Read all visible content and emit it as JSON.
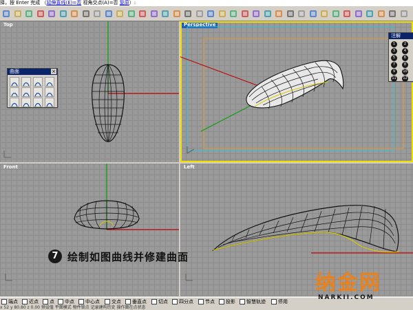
{
  "command_line": {
    "prefix": "择，按 Enter 完成 （",
    "opt1": "延伸直线(E)=否",
    "sep1": "  视角交点(A)=否",
    "opt2": "复原",
    "suffix": "）:"
  },
  "toolbar": {
    "icons": [
      "new-file-icon",
      "open-icon",
      "save-icon",
      "print-icon",
      "cut-icon",
      "copy-icon",
      "paste-icon",
      "undo-icon",
      "redo-icon",
      "hand-pan-icon",
      "rotate-view-icon",
      "zoom-dynamic-icon",
      "zoom-window-icon",
      "zoom-extents-icon",
      "zoom-selected-icon",
      "four-view-icon",
      "grid-icon",
      "construction-plane-icon",
      "set-view-icon",
      "lightbulb-icon",
      "shaded-icon",
      "rendered-icon",
      "material-icon",
      "sphere-render-icon",
      "render-icon",
      "car-icon",
      "properties-icon",
      "layer-icon",
      "object-snap-icon",
      "select-icon",
      "lock-icon",
      "wireframe-icon",
      "hide-icon",
      "show-icon",
      "edit-icon",
      "tag-icon"
    ]
  },
  "viewports": {
    "top": {
      "title": "Top"
    },
    "perspective": {
      "title": "Perspective"
    },
    "front": {
      "title": "Front"
    },
    "right": {
      "title": "Left"
    }
  },
  "surface_panel": {
    "title": "曲面"
  },
  "notes_panel": {
    "title": "注解",
    "items": [
      "1",
      "2",
      "3",
      "4",
      "5",
      "6",
      "7",
      "8",
      "9",
      "10",
      "11",
      "12"
    ]
  },
  "annotation": {
    "step_number": "7",
    "text": "绘制如图曲线并修建曲面"
  },
  "osnap": {
    "items": [
      {
        "label": "端点",
        "checked": false
      },
      {
        "label": "近点",
        "checked": false
      },
      {
        "label": "点",
        "checked": false
      },
      {
        "label": "中点",
        "checked": false
      },
      {
        "label": "中心点",
        "checked": false
      },
      {
        "label": "交点",
        "checked": false
      },
      {
        "label": "垂直点",
        "checked": false
      },
      {
        "label": "切点",
        "checked": false
      },
      {
        "label": "四分点",
        "checked": false
      },
      {
        "label": "节点",
        "checked": false
      },
      {
        "label": "投影",
        "checked": false
      },
      {
        "label": "智慧轨迹",
        "checked": false
      },
      {
        "label": "停用",
        "checked": false
      }
    ],
    "status_row": "x 52        y 80.80   z 0.00     预设值         平面模式     物件锁点     记录建构历史    操作面在点状态"
  },
  "watermark": {
    "main": "纳金网",
    "sub": "NARKII.COM"
  },
  "colors": {
    "viewport_bg": "#9a9a9a",
    "active_border": "#f0e000",
    "x_axis": "#c00000",
    "y_axis": "#00a000",
    "wm_orange": "#e8821e"
  }
}
